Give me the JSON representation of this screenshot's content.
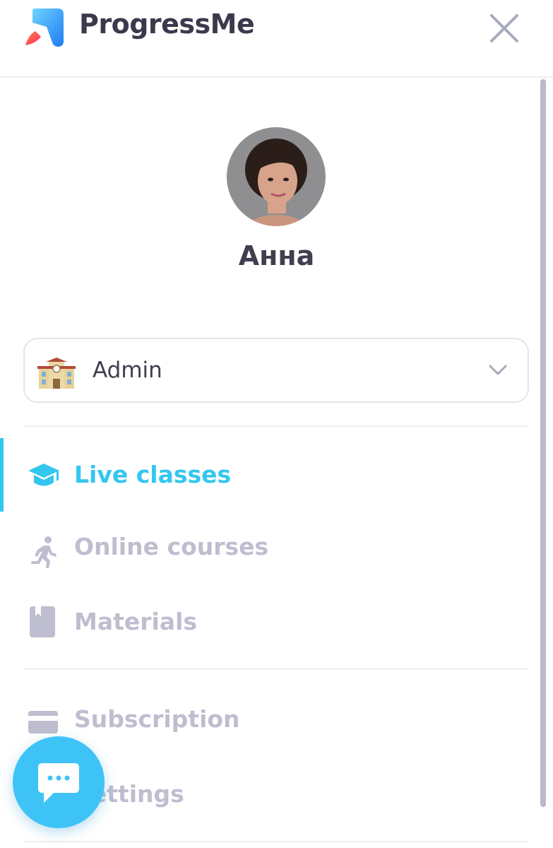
{
  "app": {
    "brand": "ProgressMe",
    "colors": {
      "accent": "#33c7f0",
      "muted": "#bebed0",
      "text": "#3f3f4f"
    }
  },
  "header": {
    "close_icon": "close-icon",
    "logo_icon": "rocket-logo-icon"
  },
  "profile": {
    "name": "Анна",
    "avatar_icon": "avatar-photo"
  },
  "role_selector": {
    "selected": "Admin",
    "icon": "school-building-icon"
  },
  "menu": {
    "live_classes": "Live classes",
    "online_courses": "Online courses",
    "materials": "Materials",
    "subscription": "Subscription",
    "settings": "Settings"
  },
  "chat_button": {
    "icon": "chat-bubble-icon"
  }
}
